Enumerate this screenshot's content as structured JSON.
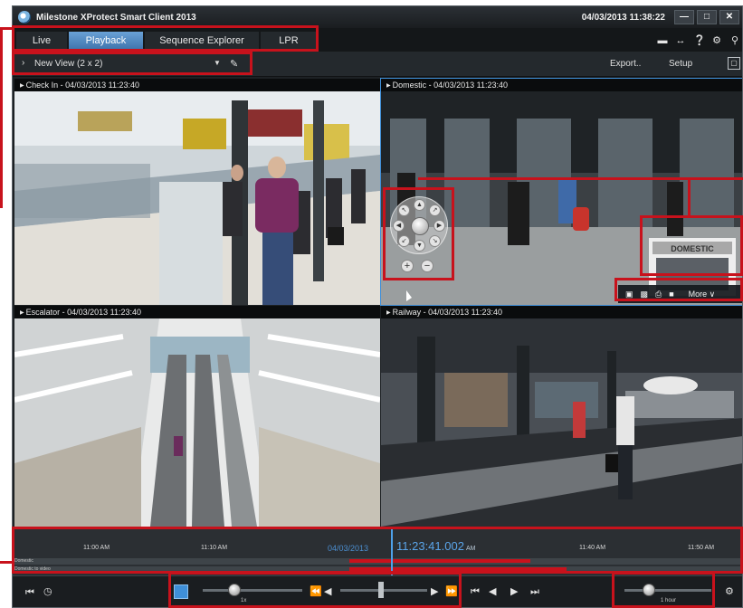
{
  "window": {
    "title": "Milestone XProtect Smart Client 2013",
    "clock": "04/03/2013 11:38:22",
    "controls": [
      "—",
      "□",
      "✕"
    ]
  },
  "tabs": [
    {
      "label": "Live",
      "active": false
    },
    {
      "label": "Playback",
      "active": true
    },
    {
      "label": "Sequence Explorer",
      "active": false
    },
    {
      "label": "LPR",
      "active": false
    }
  ],
  "top_icons": [
    "monitor-icon",
    "arrows-icon",
    "help-icon",
    "gear-icon",
    "pin-icon"
  ],
  "viewbar": {
    "view_name": "New View (2 x 2)",
    "export_label": "Export..",
    "setup_label": "Setup"
  },
  "cameras": [
    {
      "caption": "Check In - 04/03/2013 11:23:40"
    },
    {
      "caption": "Domestic - 04/03/2013 11:23:40"
    },
    {
      "caption": "Escalator - 04/03/2013 11:23:40"
    },
    {
      "caption": "Railway - 04/03/2013 11:23:40"
    }
  ],
  "camera_toolbar": {
    "more_label": "More ∨"
  },
  "overlay_sign": "DOMESTIC",
  "timeline": {
    "ticks": [
      "11:00 AM",
      "11:10 AM",
      "11:40 AM",
      "11:50 AM"
    ],
    "date": "04/03/2013",
    "current_time": "11:23:41.002",
    "current_ampm": "AM",
    "track_labels": [
      "Domestic",
      "Domestic to video"
    ]
  },
  "playback": {
    "speed_label": "1x",
    "span_label": "1 hour"
  },
  "colors": {
    "accent": "#3f8fd8",
    "highlight_red": "#c8121c",
    "tab_active": "#4f88c2"
  }
}
